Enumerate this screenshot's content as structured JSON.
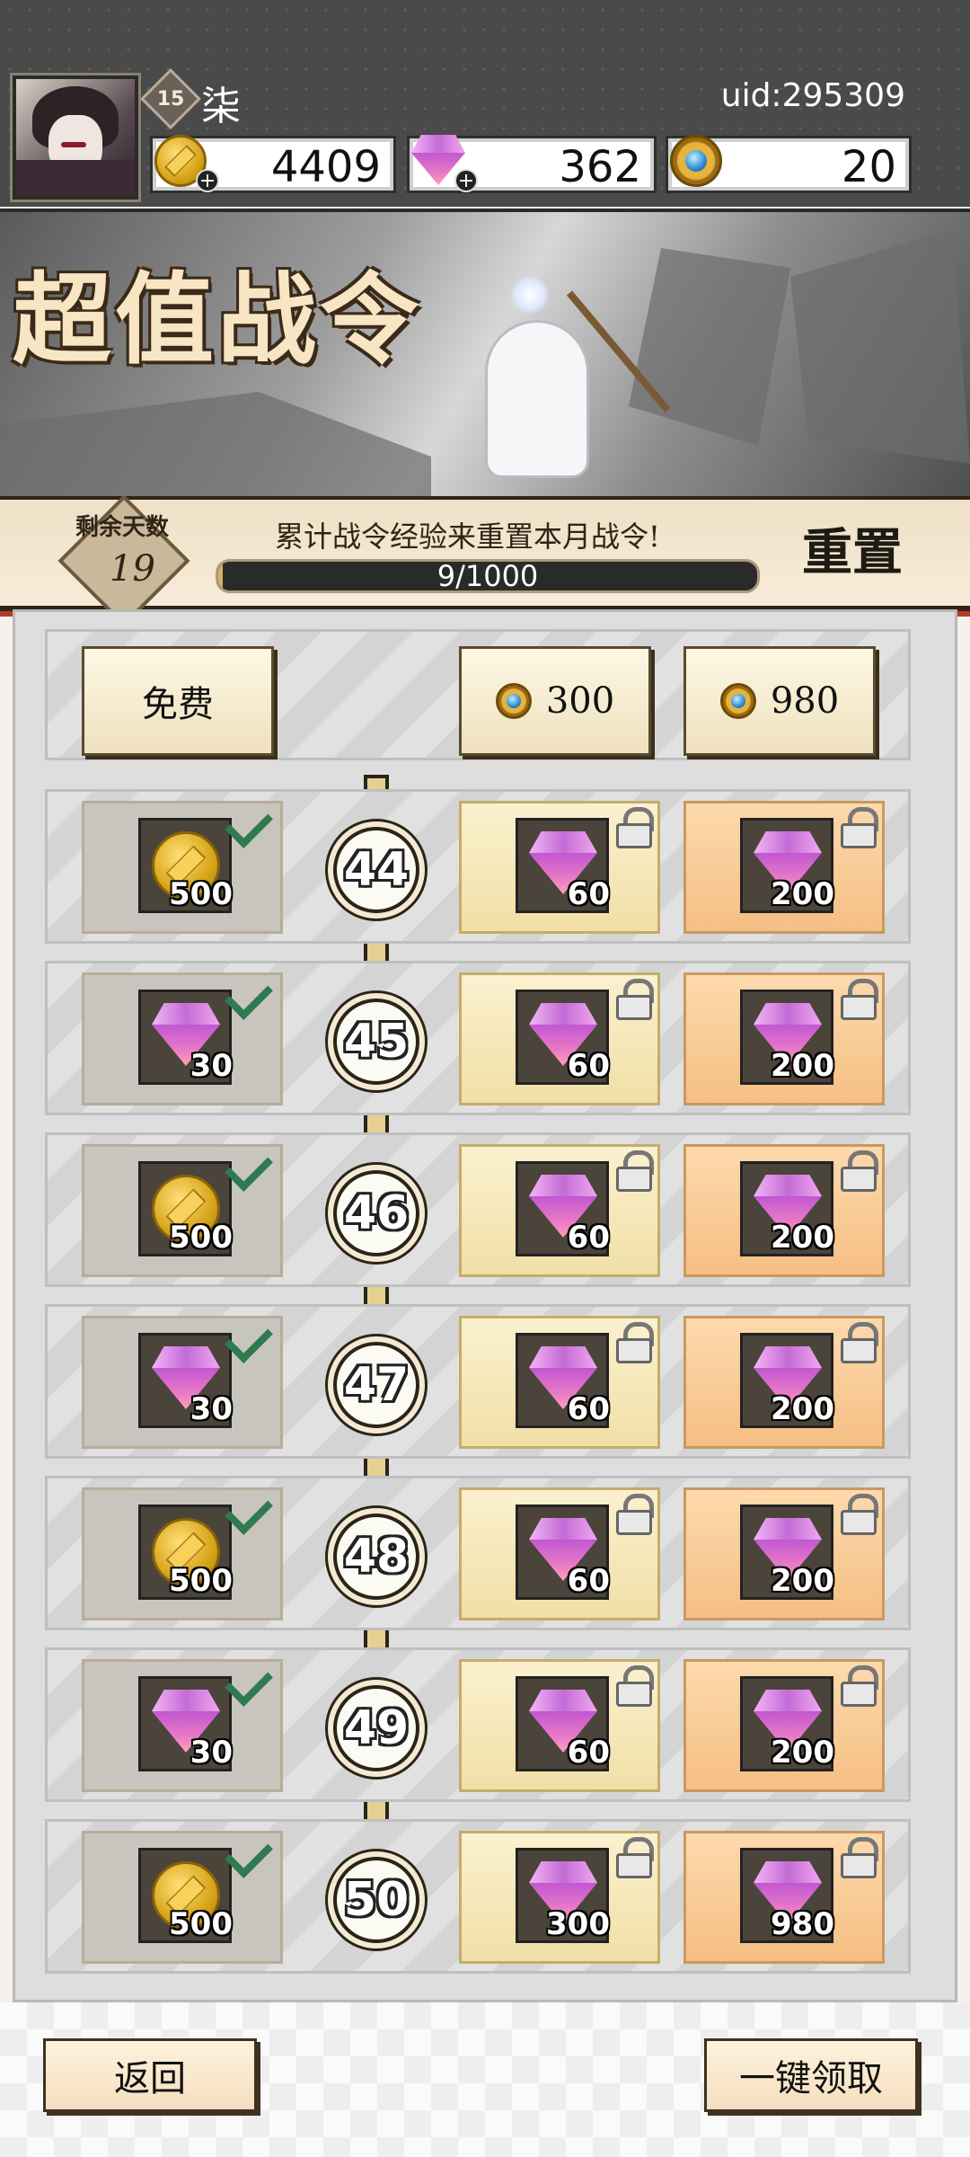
{
  "header": {
    "level": "15",
    "player_name": "柒",
    "uid": "uid:295309",
    "gold": "4409",
    "gems": "362",
    "tokens": "20"
  },
  "banner": {
    "title": "超值战令"
  },
  "status": {
    "days_label": "剩余天数",
    "days_value": "19",
    "message": "累计战令经验来重置本月战令!",
    "progress_text": "9/1000",
    "progress_fraction": 0.009,
    "reset_label": "重置"
  },
  "tiers": {
    "free_label": "免费",
    "premium1_price": "300",
    "premium2_price": "980"
  },
  "rows": [
    {
      "level": "44",
      "free": {
        "icon": "gold-coin",
        "qty": "500"
      },
      "p1": {
        "icon": "gem",
        "qty": "60"
      },
      "p2": {
        "icon": "gem",
        "qty": "200"
      }
    },
    {
      "level": "45",
      "free": {
        "icon": "gem",
        "qty": "30"
      },
      "p1": {
        "icon": "gem",
        "qty": "60"
      },
      "p2": {
        "icon": "gem",
        "qty": "200"
      }
    },
    {
      "level": "46",
      "free": {
        "icon": "gold-coin",
        "qty": "500"
      },
      "p1": {
        "icon": "gem",
        "qty": "60"
      },
      "p2": {
        "icon": "gem",
        "qty": "200"
      }
    },
    {
      "level": "47",
      "free": {
        "icon": "gem",
        "qty": "30"
      },
      "p1": {
        "icon": "gem",
        "qty": "60"
      },
      "p2": {
        "icon": "gem",
        "qty": "200"
      }
    },
    {
      "level": "48",
      "free": {
        "icon": "gold-coin",
        "qty": "500"
      },
      "p1": {
        "icon": "gem",
        "qty": "60"
      },
      "p2": {
        "icon": "gem",
        "qty": "200"
      }
    },
    {
      "level": "49",
      "free": {
        "icon": "gem",
        "qty": "30"
      },
      "p1": {
        "icon": "gem",
        "qty": "60"
      },
      "p2": {
        "icon": "gem",
        "qty": "200"
      }
    },
    {
      "level": "50",
      "free": {
        "icon": "gold-coin",
        "qty": "500"
      },
      "p1": {
        "icon": "gem",
        "qty": "300"
      },
      "p2": {
        "icon": "gem",
        "qty": "980"
      }
    }
  ],
  "footer": {
    "back_label": "返回",
    "claim_all_label": "一键领取"
  }
}
